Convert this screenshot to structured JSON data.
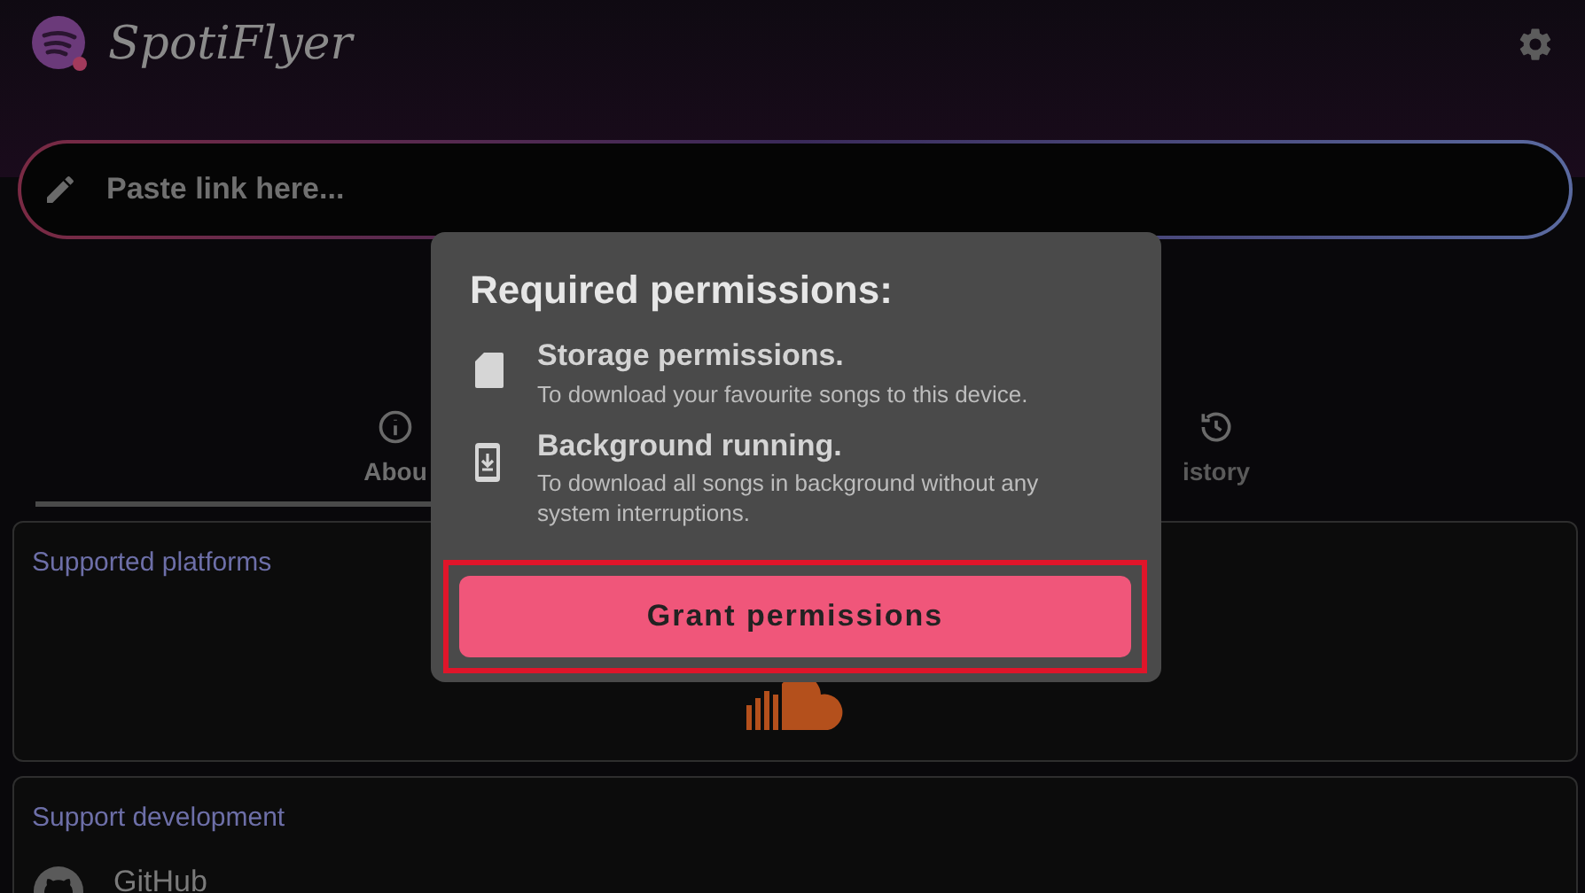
{
  "app_bar": {
    "title": "SpotiFlyer"
  },
  "search": {
    "placeholder": "Paste link here..."
  },
  "tabs": [
    {
      "label": "Abou",
      "selected": true
    },
    {
      "label": "istory",
      "selected": false
    }
  ],
  "cards": [
    {
      "kind": "platforms",
      "title": "Supported platforms"
    },
    {
      "kind": "support",
      "title": "Support development",
      "items": [
        "GitHub"
      ]
    }
  ],
  "dialog": {
    "title": "Required permissions:",
    "items": [
      {
        "kind": "storage",
        "title": "Storage permissions.",
        "description": "To download your favourite songs to this device."
      },
      {
        "kind": "background",
        "title": "Background running.",
        "description": "To download all songs in background without any system interruptions."
      }
    ],
    "button": {
      "label": "Grant permissions",
      "highlighted": true
    }
  }
}
